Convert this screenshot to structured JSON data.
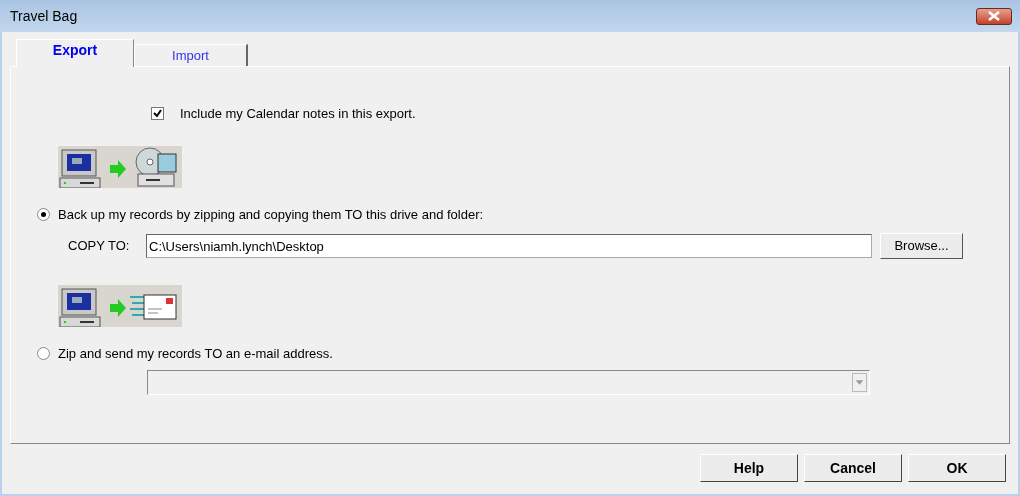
{
  "window": {
    "title": "Travel Bag"
  },
  "tabs": [
    {
      "label": "Export",
      "selected": true
    },
    {
      "label": "Import",
      "selected": false
    }
  ],
  "include_notes": {
    "label": "Include my Calendar notes in this export.",
    "checked": true
  },
  "options": [
    {
      "kind": "folder",
      "label": "Back up my records by zipping and copying them TO this drive and folder:",
      "selected": true,
      "field_label": "COPY TO:",
      "value": "C:\\Users\\niamh.lynch\\Desktop",
      "button": "Browse..."
    },
    {
      "kind": "email",
      "label": "Zip and send my records TO an e-mail address.",
      "selected": false,
      "dropdown_disabled": true
    }
  ],
  "buttons": [
    "Help",
    "Cancel",
    "OK"
  ]
}
